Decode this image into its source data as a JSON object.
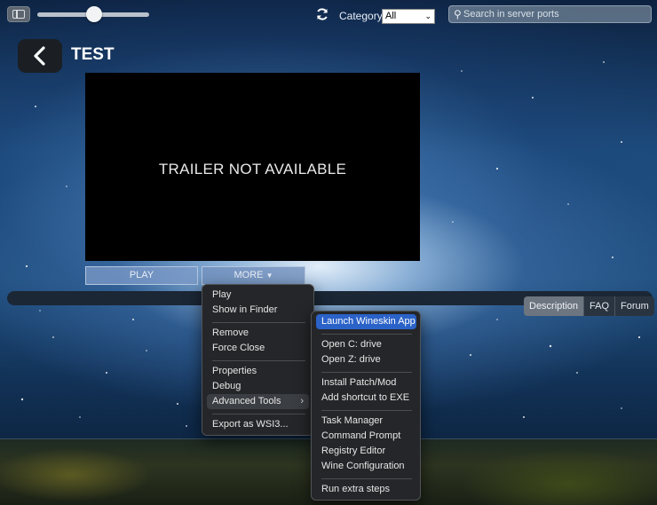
{
  "toolbar": {
    "sidebar_icon": "sidebar-toggle-icon",
    "zoom_slider_value": 0.44,
    "refresh_icon": "refresh-icon",
    "category_label": "Category:",
    "category_value": "All",
    "search_placeholder": "Search in server ports",
    "search_icon": "search-icon"
  },
  "header": {
    "back_icon": "chevron-left-icon",
    "title": "TEST"
  },
  "trailer": {
    "message": "TRAILER NOT AVAILABLE"
  },
  "actions": {
    "play_label": "PLAY",
    "more_label": "MORE",
    "more_icon": "caret-down-icon"
  },
  "tabs": [
    {
      "label": "Description",
      "active": true
    },
    {
      "label": "FAQ",
      "active": false
    },
    {
      "label": "Forum",
      "active": false
    }
  ],
  "context_menu": {
    "items": {
      "play": "Play",
      "show_in_finder": "Show in Finder",
      "remove": "Remove",
      "force_close": "Force Close",
      "properties": "Properties",
      "debug": "Debug",
      "advanced_tools": "Advanced Tools",
      "export": "Export as WSI3..."
    }
  },
  "submenu": {
    "items": {
      "launch_wineskin": "Launch Wineskin App",
      "open_c": "Open C: drive",
      "open_z": "Open Z: drive",
      "install_patch": "Install Patch/Mod",
      "add_shortcut": "Add shortcut to EXE",
      "task_manager": "Task Manager",
      "command_prompt": "Command Prompt",
      "registry_editor": "Registry Editor",
      "wine_config": "Wine Configuration",
      "run_extra": "Run extra steps"
    }
  },
  "colors": {
    "menu_highlight": "#2b62c8",
    "menu_background": "#242629",
    "tab_active": "#6d7680"
  }
}
